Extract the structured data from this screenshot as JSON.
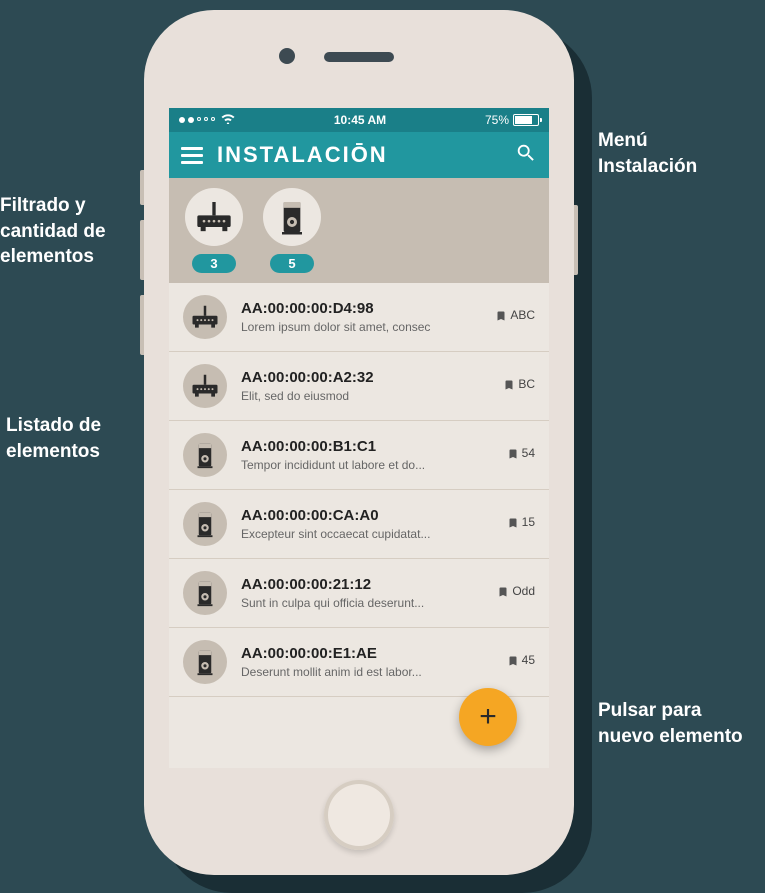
{
  "statusbar": {
    "time": "10:45 AM",
    "battery_pct": "75%"
  },
  "appbar": {
    "title": "INSTALACIŌN"
  },
  "filters": [
    {
      "type": "router",
      "count": "3"
    },
    {
      "type": "speaker",
      "count": "5"
    }
  ],
  "items": [
    {
      "icon": "router",
      "mac": "AA:00:00:00:D4:98",
      "sub": "Lorem ipsum dolor sit amet, consec",
      "tag": "ABC"
    },
    {
      "icon": "router",
      "mac": "AA:00:00:00:A2:32",
      "sub": "Elit, sed do eiusmod",
      "tag": "BC"
    },
    {
      "icon": "speaker",
      "mac": "AA:00:00:00:B1:C1",
      "sub": "Tempor incididunt ut labore et do...",
      "tag": "54"
    },
    {
      "icon": "speaker",
      "mac": "AA:00:00:00:CA:A0",
      "sub": "Excepteur sint occaecat cupidatat...",
      "tag": "15"
    },
    {
      "icon": "speaker",
      "mac": "AA:00:00:00:21:12",
      "sub": "Sunt in culpa qui officia deserunt...",
      "tag": "Odd"
    },
    {
      "icon": "speaker",
      "mac": "AA:00:00:00:E1:AE",
      "sub": "Deserunt mollit anim id est labor...",
      "tag": "45"
    }
  ],
  "callouts": {
    "top_right": "Menú\nInstalación",
    "top_left": "Filtrado y\ncantidad de\nelementos",
    "mid_left": "Listado de\nelementos",
    "bottom_right": "Pulsar para\nnuevo elemento"
  }
}
